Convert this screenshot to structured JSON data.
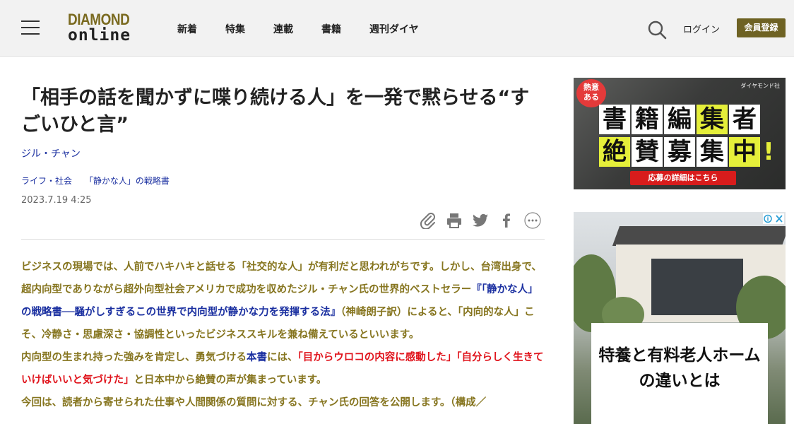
{
  "header": {
    "logo_top": "DIAMOND",
    "logo_bottom": "online",
    "nav": [
      "新着",
      "特集",
      "連載",
      "書籍",
      "週刊ダイヤ"
    ],
    "login_label": "ログイン",
    "register_label": "会員登録"
  },
  "article": {
    "title": "「相手の話を聞かずに喋り続ける人」を一発で黙らせる“すごいひと言”",
    "author": "ジル・チャン",
    "category": "ライフ・社会",
    "series": "「静かな人」の戦略書",
    "date": "2023.7.19 4:25",
    "share_icons": [
      "clip-icon",
      "print-icon",
      "twitter-icon",
      "facebook-icon",
      "more-icon"
    ],
    "p1_a": "ビジネスの現場では、人前でハキハキと話せる「社交的な人」が有利だと思われがちです。しかし、台湾出身で、超内向型でありながら超外向型社会アメリカで成功を収めたジル・チャン氏の世界的ベストセラー",
    "p1_link": "『「静かな人」の戦略書──騒がしすぎるこの世界で内向型が静かな力を発揮する法』",
    "p1_b": "（神崎朗子訳）によると、「内向的な人」こそ、冷静さ・思慮深さ・協調性といったビジネススキルを兼ね備えているといいます。",
    "p2_a": "内向型の生まれ持った強みを肯定し、勇気づける",
    "p2_link": "本書",
    "p2_b": "には、",
    "p2_red": "「目からウロコの内容に感動した」「自分らしく生きていけばいいと気づけた」",
    "p2_c": "と日本中から絶賛の声が集まっています。",
    "p3": "今回は、読者から寄せられた仕事や人間関係の質問に対する、チャン氏の回答を公開します。（構成／"
  },
  "ads": {
    "ad1": {
      "badge_line1": "熱意",
      "badge_line2": "ある",
      "publisher": "ダイヤモンド社",
      "row1": [
        "書",
        "籍",
        "編",
        "集",
        "者"
      ],
      "row2": [
        "絶",
        "賛",
        "募",
        "集",
        "中",
        "!"
      ],
      "cta": "応募の詳細はこちら"
    },
    "ad2": {
      "text": "特養と有料老人ホームの違いとは"
    }
  },
  "colors": {
    "header_bg": "#f2f2f2",
    "brand_gold": "#86751f",
    "link_blue": "#1a2fa0",
    "highlight_red": "#e0141c",
    "register_bg": "#6e6223"
  }
}
